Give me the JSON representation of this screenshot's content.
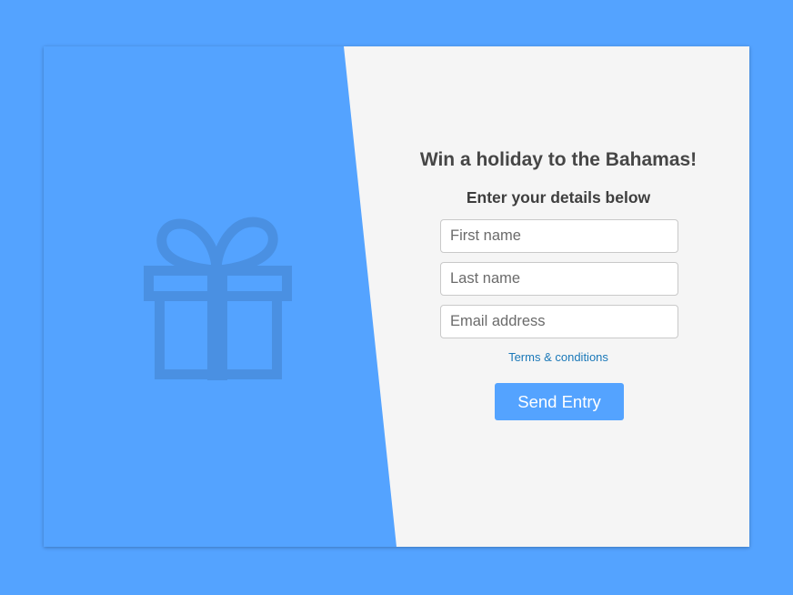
{
  "theme": {
    "accent": "#54a3ff",
    "card_background": "#f5f5f5",
    "gift_icon_color": "#4a90e2",
    "link_color": "#1a78b8"
  },
  "hero": {
    "icon": "gift-icon"
  },
  "form": {
    "title": "Win a holiday to the Bahamas!",
    "subtitle": "Enter your details below",
    "first_name_placeholder": "First name",
    "last_name_placeholder": "Last name",
    "email_placeholder": "Email address",
    "terms_label": "Terms & conditions",
    "submit_label": "Send Entry"
  }
}
